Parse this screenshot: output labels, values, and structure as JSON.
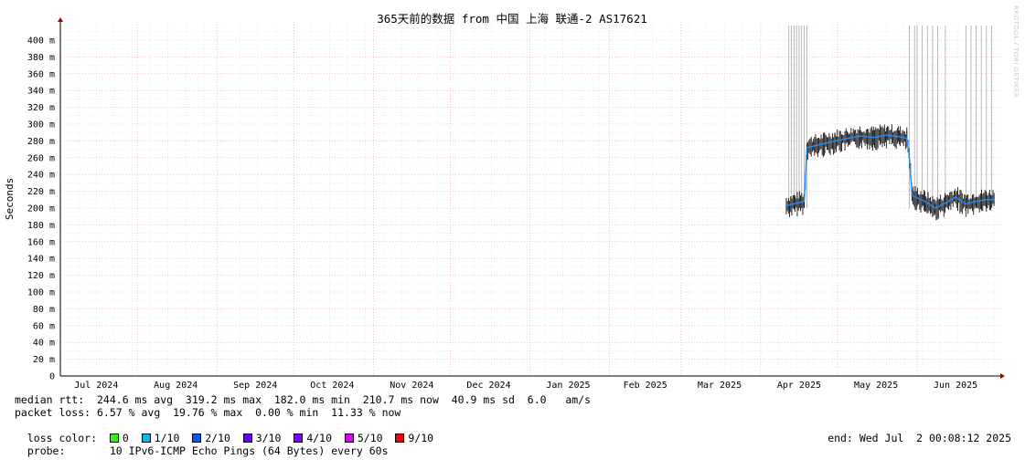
{
  "chart_data": {
    "type": "line",
    "title": "365天前的数据 from 中国 上海 联通-2 AS17621",
    "ylabel": "Seconds",
    "yticks": [
      "0",
      "20 m",
      "40 m",
      "60 m",
      "80 m",
      "100 m",
      "120 m",
      "140 m",
      "160 m",
      "180 m",
      "200 m",
      "220 m",
      "240 m",
      "260 m",
      "280 m",
      "300 m",
      "320 m",
      "340 m",
      "360 m",
      "380 m",
      "400 m"
    ],
    "ylim_ms": [
      0,
      420
    ],
    "xlim": [
      "2024-07-02",
      "2025-07-02"
    ],
    "month_labels": [
      {
        "label": "Jul 2024",
        "date": "2024-07-16"
      },
      {
        "label": "Aug 2024",
        "date": "2024-08-16"
      },
      {
        "label": "Sep 2024",
        "date": "2024-09-16"
      },
      {
        "label": "Oct 2024",
        "date": "2024-10-16"
      },
      {
        "label": "Nov 2024",
        "date": "2024-11-16"
      },
      {
        "label": "Dec 2024",
        "date": "2024-12-16"
      },
      {
        "label": "Jan 2025",
        "date": "2025-01-16"
      },
      {
        "label": "Feb 2025",
        "date": "2025-02-15"
      },
      {
        "label": "Mar 2025",
        "date": "2025-03-16"
      },
      {
        "label": "Apr 2025",
        "date": "2025-04-16"
      },
      {
        "label": "May 2025",
        "date": "2025-05-16"
      },
      {
        "label": "Jun 2025",
        "date": "2025-06-16"
      }
    ],
    "series": [
      {
        "type": "median_rtt",
        "color": "#1e90ff",
        "points": [
          {
            "date": "2025-04-11",
            "ms": 203
          },
          {
            "date": "2025-04-14",
            "ms": 205
          },
          {
            "date": "2025-04-18",
            "ms": 208
          },
          {
            "date": "2025-04-19",
            "ms": 272
          },
          {
            "date": "2025-04-22",
            "ms": 274
          },
          {
            "date": "2025-04-26",
            "ms": 277
          },
          {
            "date": "2025-04-30",
            "ms": 280
          },
          {
            "date": "2025-05-05",
            "ms": 283
          },
          {
            "date": "2025-05-10",
            "ms": 286
          },
          {
            "date": "2025-05-15",
            "ms": 284
          },
          {
            "date": "2025-05-20",
            "ms": 287
          },
          {
            "date": "2025-05-25",
            "ms": 285
          },
          {
            "date": "2025-05-28",
            "ms": 283
          },
          {
            "date": "2025-05-29",
            "ms": 260
          },
          {
            "date": "2025-05-30",
            "ms": 215
          },
          {
            "date": "2025-06-04",
            "ms": 208
          },
          {
            "date": "2025-06-08",
            "ms": 200
          },
          {
            "date": "2025-06-12",
            "ms": 206
          },
          {
            "date": "2025-06-16",
            "ms": 213
          },
          {
            "date": "2025-06-20",
            "ms": 205
          },
          {
            "date": "2025-06-24",
            "ms": 208
          },
          {
            "date": "2025-06-28",
            "ms": 210
          },
          {
            "date": "2025-07-01",
            "ms": 210
          }
        ]
      }
    ],
    "loss_markers": [
      "2025-04-12",
      "2025-04-13",
      "2025-04-14",
      "2025-04-15",
      "2025-04-16",
      "2025-04-17",
      "2025-04-18",
      "2025-04-19",
      "2025-05-29",
      "2025-05-31",
      "2025-06-01",
      "2025-06-03",
      "2025-06-05",
      "2025-06-07",
      "2025-06-09",
      "2025-06-12",
      "2025-06-20",
      "2025-06-22",
      "2025-06-24",
      "2025-06-26",
      "2025-06-28",
      "2025-06-30"
    ],
    "grid": true
  },
  "legend": {
    "median_rtt": "median rtt:  244.6 ms avg  319.2 ms max  182.0 ms min  210.7 ms now  40.9 ms sd  6.0   am/s",
    "packet_loss": "packet loss: 6.57 % avg  19.76 % max  0.00 % min  11.33 % now",
    "loss_color_label": "loss color:",
    "loss_colors": [
      {
        "label": "0",
        "color": "#26ff00"
      },
      {
        "label": "1/10",
        "color": "#00b8ff"
      },
      {
        "label": "2/10",
        "color": "#0059ff"
      },
      {
        "label": "3/10",
        "color": "#5e00ff"
      },
      {
        "label": "4/10",
        "color": "#7e00ff"
      },
      {
        "label": "5/10",
        "color": "#dd00ff"
      },
      {
        "label": "9/10",
        "color": "#ff0000"
      }
    ],
    "probe_label": "probe:",
    "probe": "10 IPv6-ICMP Echo Pings (64 Bytes) every 60s",
    "end": "end: Wed Jul  2 00:08:12 2025"
  },
  "watermark": "RRDTOOL / TOBI OETIKER"
}
